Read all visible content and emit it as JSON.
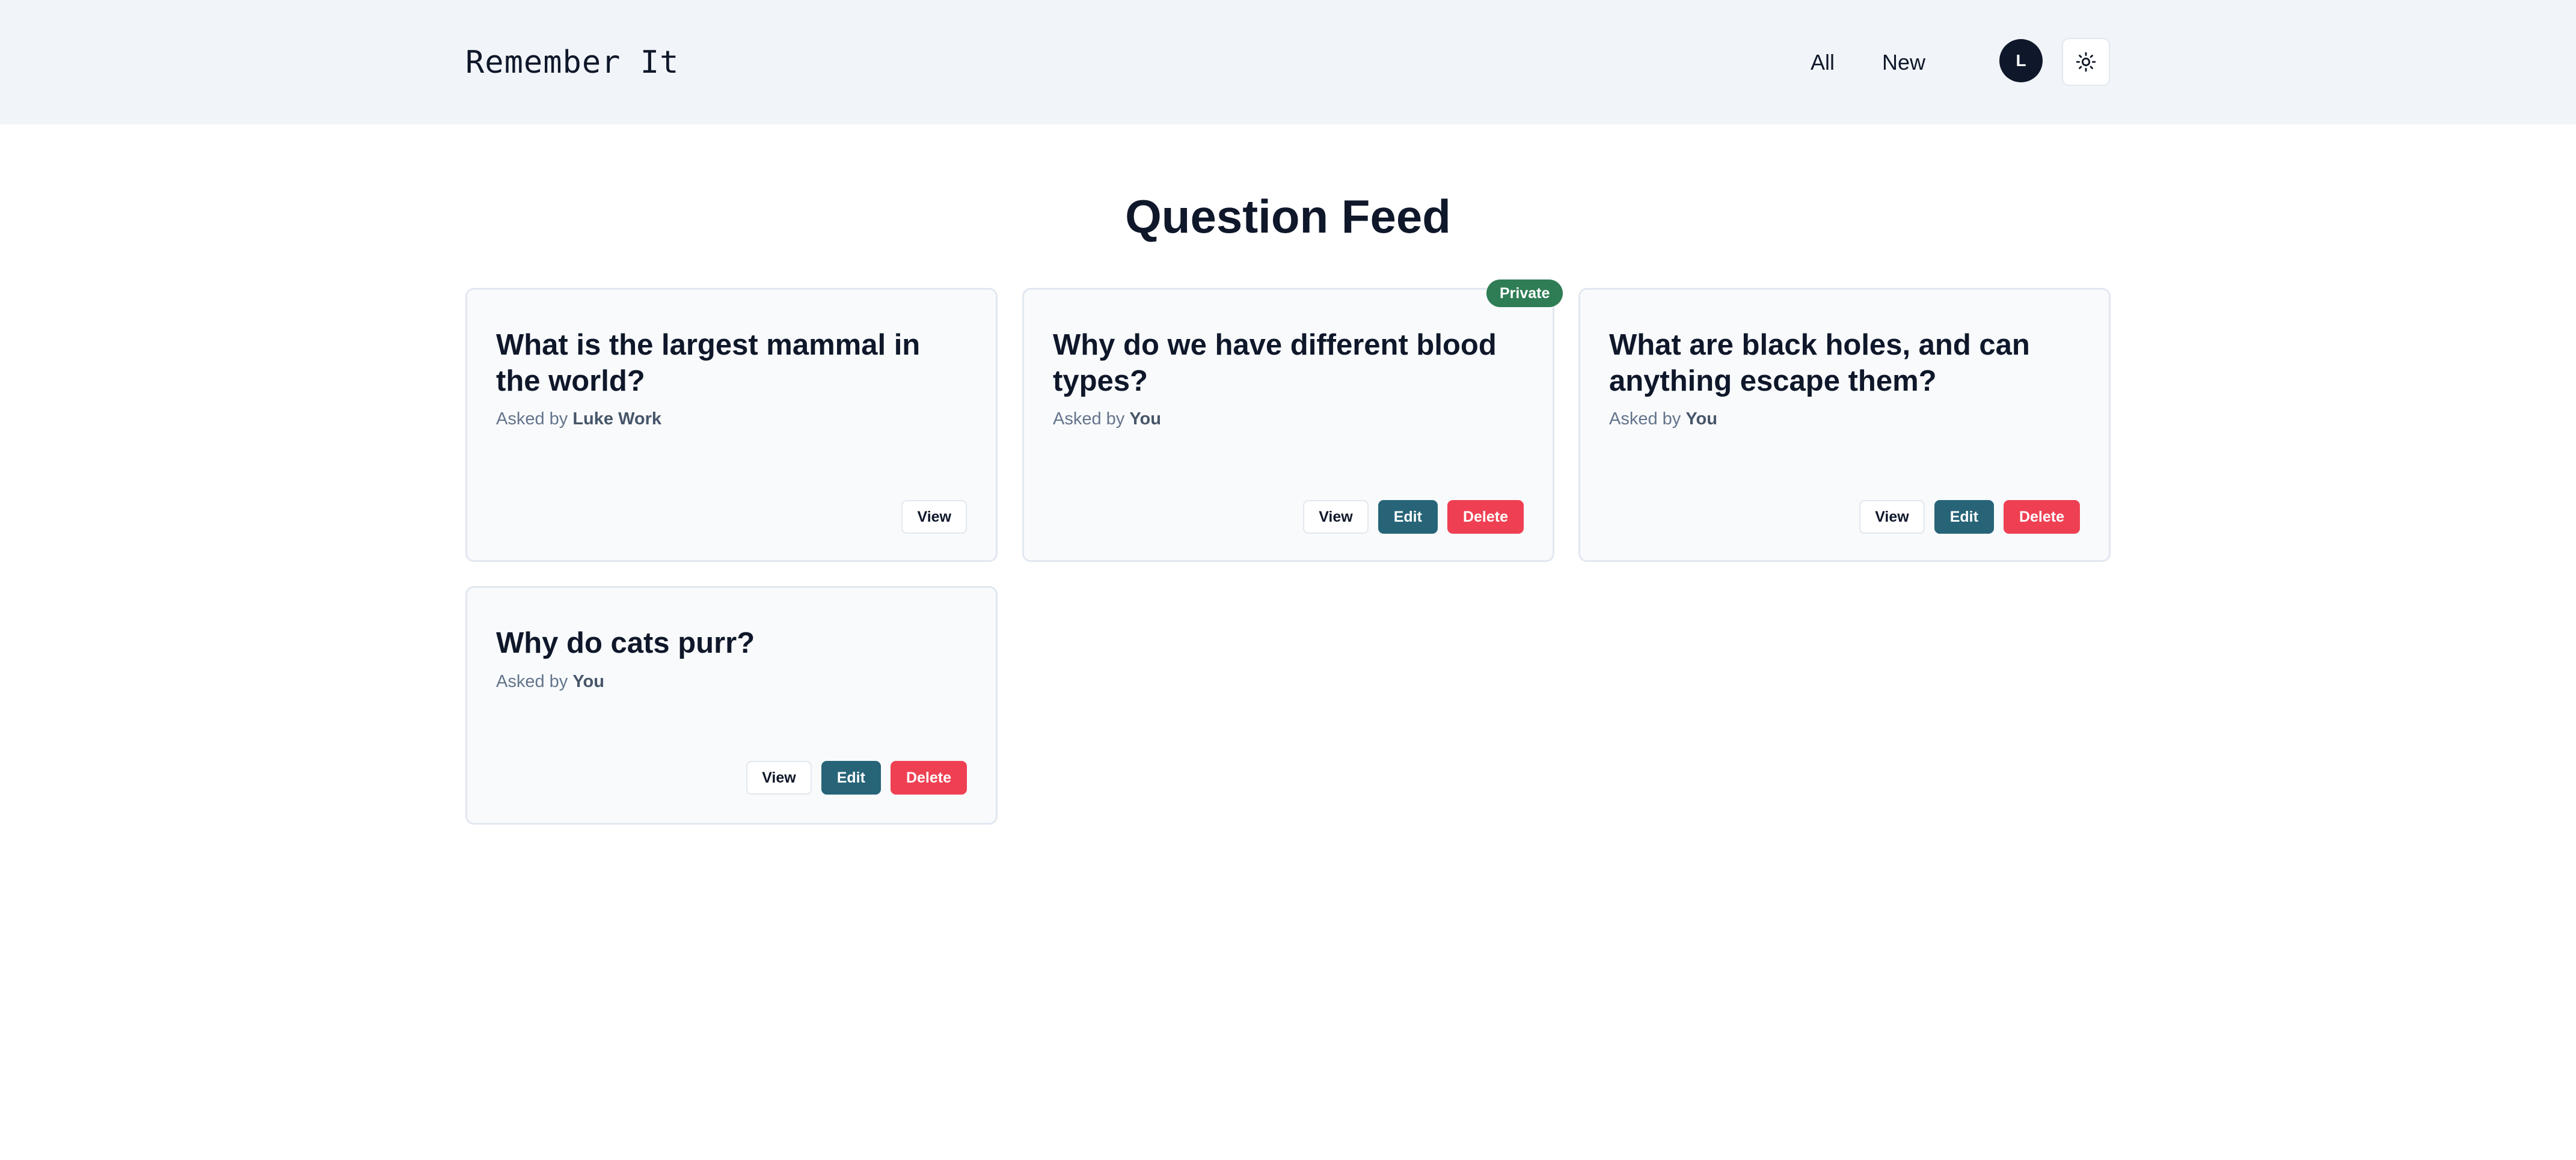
{
  "header": {
    "logo": "Remember It",
    "nav": {
      "all": "All",
      "new": "New"
    },
    "avatar_initial": "L",
    "theme_icon": "sun-icon"
  },
  "main": {
    "title": "Question Feed",
    "cards": [
      {
        "title": "What is the largest mammal in the world?",
        "asked_by_prefix": "Asked by",
        "author": "Luke Work",
        "actions": {
          "view": "View"
        }
      },
      {
        "title": "Why do we have different blood types?",
        "asked_by_prefix": "Asked by",
        "author": "You",
        "badge": "Private",
        "actions": {
          "view": "View",
          "edit": "Edit",
          "delete": "Delete"
        }
      },
      {
        "title": "What are black holes, and can anything escape them?",
        "asked_by_prefix": "Asked by",
        "author": "You",
        "actions": {
          "view": "View",
          "edit": "Edit",
          "delete": "Delete"
        }
      },
      {
        "title": "Why do cats purr?",
        "asked_by_prefix": "Asked by",
        "author": "You",
        "actions": {
          "view": "View",
          "edit": "Edit",
          "delete": "Delete"
        }
      }
    ]
  },
  "colors": {
    "header_bg": "#f1f5f9",
    "card_bg": "#f8fafc",
    "edit_button": "#276478",
    "delete_button": "#ef4053",
    "private_badge": "#2f7d55",
    "avatar_bg": "#0f172a"
  }
}
